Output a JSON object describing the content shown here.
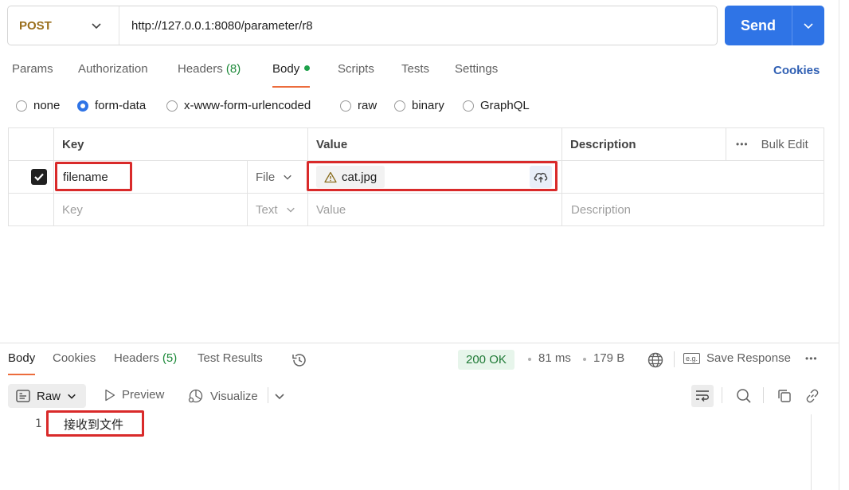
{
  "request": {
    "method": "POST",
    "url": "http://127.0.0.1:8080/parameter/r8",
    "send_label": "Send"
  },
  "request_tabs": [
    {
      "label": "Params"
    },
    {
      "label": "Authorization"
    },
    {
      "label": "Headers",
      "count": "(8)"
    },
    {
      "label": "Body",
      "active": true
    },
    {
      "label": "Scripts"
    },
    {
      "label": "Tests"
    },
    {
      "label": "Settings"
    }
  ],
  "cookies_link": "Cookies",
  "body_types": [
    {
      "label": "none",
      "checked": false
    },
    {
      "label": "form-data",
      "checked": true
    },
    {
      "label": "x-www-form-urlencoded",
      "checked": false
    },
    {
      "label": "raw",
      "checked": false
    },
    {
      "label": "binary",
      "checked": false
    },
    {
      "label": "GraphQL",
      "checked": false
    }
  ],
  "table": {
    "headers": {
      "key": "Key",
      "value": "Value",
      "description": "Description",
      "bulk_edit": "Bulk Edit"
    },
    "rows": [
      {
        "checked": true,
        "key": "filename",
        "type": "File",
        "value": "cat.jpg",
        "description": ""
      }
    ],
    "empty_row": {
      "key": "Key",
      "type": "Text",
      "value": "Value",
      "description": "Description"
    }
  },
  "response": {
    "tabs": [
      {
        "label": "Body",
        "active": true
      },
      {
        "label": "Cookies"
      },
      {
        "label": "Headers",
        "count": "(5)"
      },
      {
        "label": "Test Results"
      }
    ],
    "status": "200 OK",
    "time": "81 ms",
    "size": "179 B",
    "save_response": "Save Response",
    "view_mode": "Raw",
    "preview_label": "Preview",
    "visualize_label": "Visualize",
    "lines": [
      {
        "no": "1",
        "text": "接收到文件"
      }
    ]
  },
  "colors": {
    "accent": "#2f74e6",
    "highlight_box": "#d92a2a",
    "active_tab_underline": "#ec6c3c",
    "status_ok": "#1f7a36"
  }
}
